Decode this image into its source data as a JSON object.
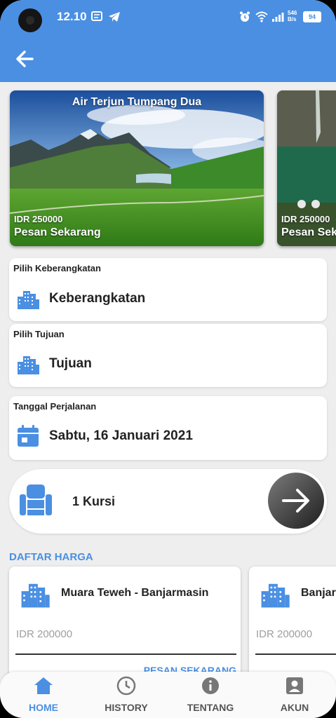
{
  "status_bar": {
    "time": "12.10",
    "net_speed_top": "546",
    "net_speed_bottom": "B/s",
    "battery": "94"
  },
  "carousel": [
    {
      "title": "Air Terjun Tumpang Dua",
      "price": "IDR 250000",
      "order_label": "Pesan Sekarang"
    },
    {
      "title": "",
      "price": "IDR 250000",
      "order_label": "Pesan Sekarang"
    }
  ],
  "departure": {
    "label": "Pilih Keberangkatan",
    "value": "Keberangkatan"
  },
  "destination": {
    "label": "Pilih Tujuan",
    "value": "Tujuan"
  },
  "date": {
    "label": "Tanggal Perjalanan",
    "value": "Sabtu, 16 Januari 2021"
  },
  "seats": {
    "value": "1 Kursi"
  },
  "price_list": {
    "heading": "DAFTAR HARGA",
    "items": [
      {
        "route": "Muara Teweh - Banjarmasin",
        "price": "IDR 200000",
        "button": "PESAN SEKARANG"
      },
      {
        "route": "Banjarmasin",
        "price": "IDR 200000",
        "button": ""
      }
    ]
  },
  "nav": {
    "items": [
      {
        "label": "HOME",
        "active": true
      },
      {
        "label": "HISTORY",
        "active": false
      },
      {
        "label": "TENTANG",
        "active": false
      },
      {
        "label": "AKUN",
        "active": false
      }
    ]
  },
  "colors": {
    "primary": "#4a8fe2",
    "background": "#eeeeee"
  }
}
